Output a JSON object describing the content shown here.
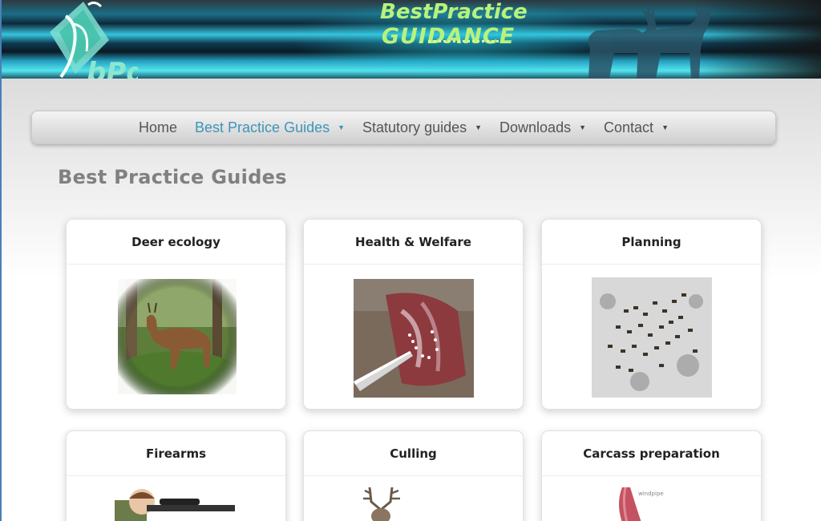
{
  "site": {
    "logo_text": "bPg",
    "title_line1": "BestPractice",
    "title_line2": "GUIDANCE"
  },
  "nav": {
    "items": [
      {
        "label": "Home",
        "has_dropdown": false,
        "active": false
      },
      {
        "label": "Best Practice Guides",
        "has_dropdown": true,
        "active": true
      },
      {
        "label": "Statutory guides",
        "has_dropdown": true,
        "active": false
      },
      {
        "label": "Downloads",
        "has_dropdown": true,
        "active": false
      },
      {
        "label": "Contact",
        "has_dropdown": true,
        "active": false
      }
    ],
    "dropdown_glyph": "▼"
  },
  "page": {
    "title": "Best Practice Guides"
  },
  "cards": [
    {
      "title": "Deer ecology",
      "image": "roe-deer-in-forest-image"
    },
    {
      "title": "Health & Welfare",
      "image": "carcass-inspection-image"
    },
    {
      "title": "Planning",
      "image": "deer-herd-in-snow-image"
    },
    {
      "title": "Firearms",
      "image": "child-with-rifle-image"
    },
    {
      "title": "Culling",
      "image": "stag-antlers-image"
    },
    {
      "title": "Carcass preparation",
      "image": "windpipe-diagram-image"
    }
  ],
  "image_labels": {
    "windpipe": "windpipe"
  },
  "colors": {
    "nav_active": "#3c95b8",
    "nav_text": "#555555",
    "title_green": "#b9f27a",
    "page_title": "#808080"
  }
}
